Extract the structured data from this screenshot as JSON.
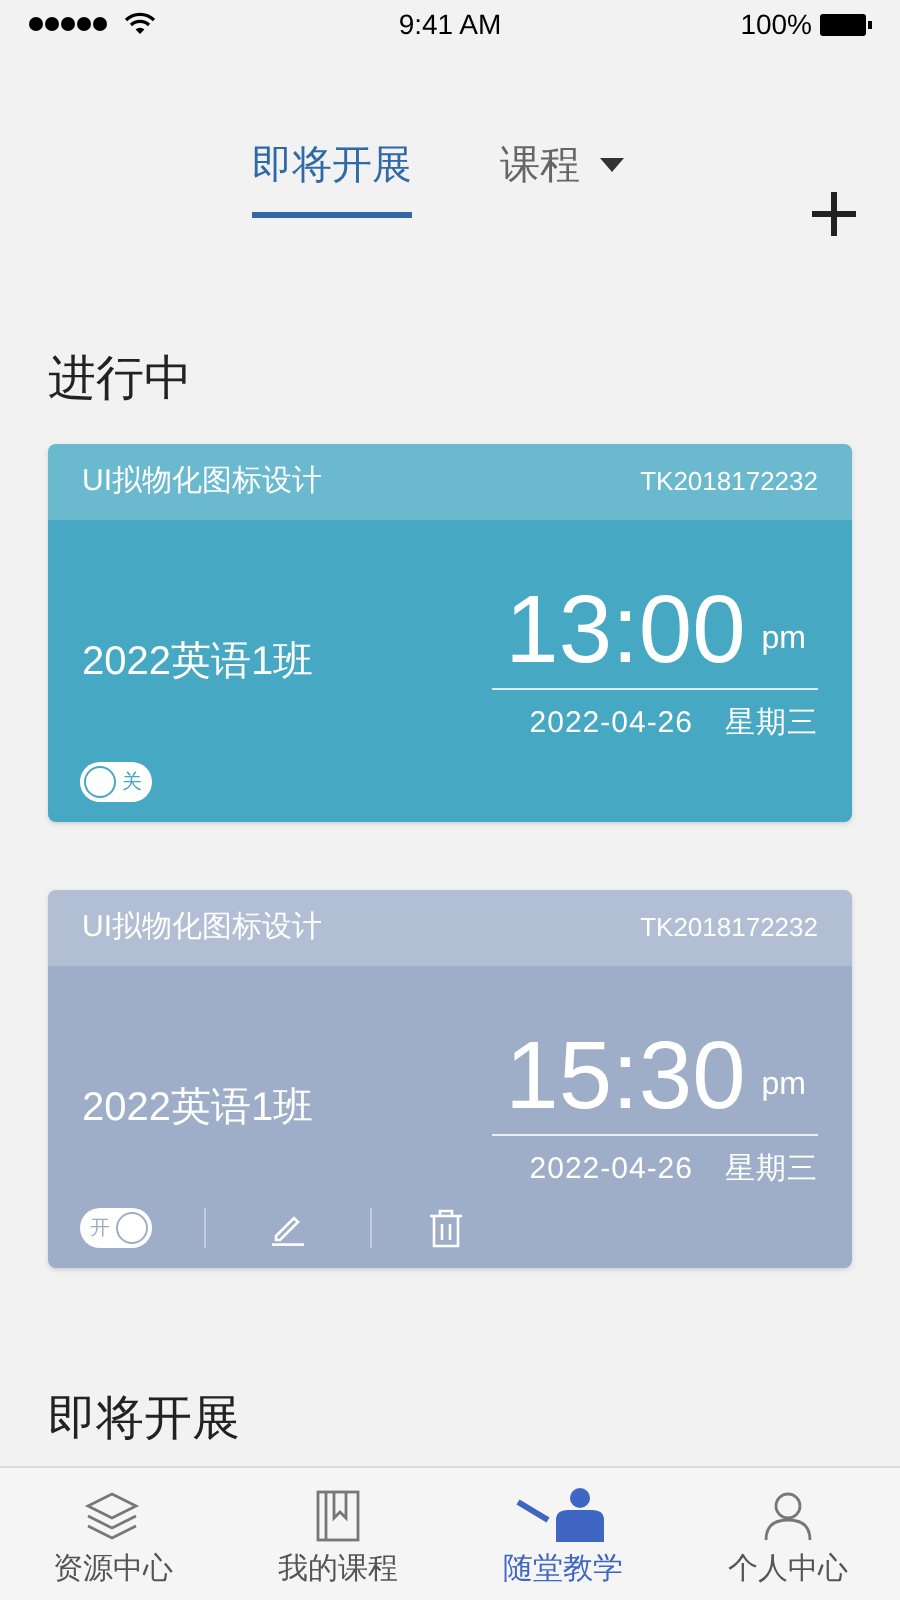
{
  "status_bar": {
    "time": "9:41 AM",
    "battery": "100%"
  },
  "tabs": [
    {
      "label": "即将开展",
      "selected": true,
      "dropdown": false
    },
    {
      "label": "课程",
      "selected": false,
      "dropdown": true
    }
  ],
  "sections": [
    {
      "title": "进行中",
      "cards": [
        {
          "course": "UI拟物化图标设计",
          "code": "TK2018172232",
          "class_name": "2022英语1班",
          "time": "13:00",
          "ampm": "pm",
          "date": "2022-04-26",
          "weekday": "星期三",
          "color": "#46a8c2",
          "switch_label": "关",
          "on": false,
          "editable": false
        },
        {
          "course": "UI拟物化图标设计",
          "code": "TK2018172232",
          "class_name": "2022英语1班",
          "time": "15:30",
          "ampm": "pm",
          "date": "2022-04-26",
          "weekday": "星期三",
          "color": "#9eaec8",
          "switch_label": "开",
          "on": true,
          "editable": true
        }
      ]
    },
    {
      "title": "即将开展"
    }
  ],
  "nav": [
    {
      "label": "资源中心",
      "kind": "layers",
      "selected": false
    },
    {
      "label": "我的课程",
      "kind": "book",
      "selected": false
    },
    {
      "label": "随堂教学",
      "kind": "teacher",
      "selected": true
    },
    {
      "label": "个人中心",
      "kind": "person",
      "selected": false
    }
  ]
}
